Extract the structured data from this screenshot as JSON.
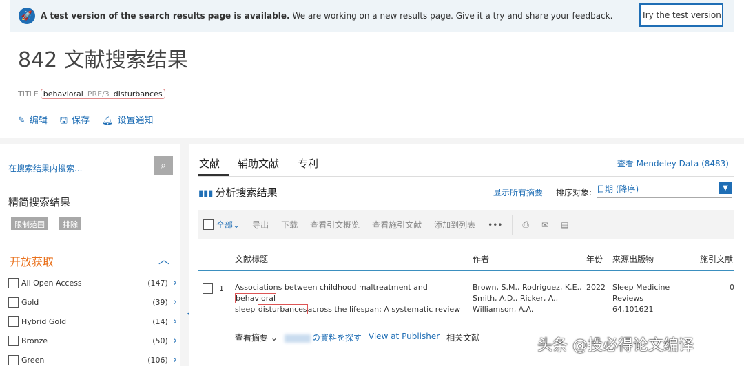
{
  "banner": {
    "bold": "A test version of the search results page is available.",
    "text": "We are working on a new results page. Give it a try and share your feedback.",
    "button": "Try the test version"
  },
  "header": {
    "title": "842 文献搜索结果",
    "field": "TITLE",
    "term1": "behavioral",
    "operator": "PRE/3",
    "term2": "disturbances",
    "actions": [
      "编辑",
      "保存",
      "设置通知"
    ]
  },
  "sidebar": {
    "search_placeholder": "在搜索结果内搜索...",
    "refine": "精简搜索结果",
    "limit": "限制范围",
    "exclude": "排除",
    "section": "开放获取",
    "filters": [
      {
        "label": "All Open Access",
        "count": "(147)"
      },
      {
        "label": "Gold",
        "count": "(39)"
      },
      {
        "label": "Hybrid Gold",
        "count": "(14)"
      },
      {
        "label": "Bronze",
        "count": "(50)"
      },
      {
        "label": "Green",
        "count": "(106)"
      }
    ]
  },
  "main": {
    "tabs": [
      "文献",
      "辅助文献",
      "专利"
    ],
    "mendeley": "查看 Mendeley Data (8483)",
    "analysis": "分析搜索结果",
    "show_all": "显示所有摘要",
    "sort_label": "排序对象:",
    "sort_value": "日期 (降序)",
    "toolbar": {
      "all": "全部",
      "items": [
        "导出",
        "下载",
        "查看引文概览",
        "查看施引文献",
        "添加到列表",
        "•••"
      ]
    },
    "columns": [
      "文献标题",
      "作者",
      "年份",
      "来源出版物",
      "施引文献"
    ],
    "rows": [
      {
        "num": "1",
        "title_a": "Associations between childhood maltreatment and",
        "hl1": "behavioral",
        "title_b": "sleep",
        "hl2": "disturbances",
        "title_c": "across the lifespan: A systematic review",
        "authors1": "Brown, S.M., Rodriguez, K.E.,",
        "authors2": "Smith, A.D., Ricker, A.,",
        "authors3": "Williamson, A.A.",
        "year": "2022",
        "source1": "Sleep Medicine",
        "source2": "Reviews",
        "source3": "64,101621",
        "cited": "0",
        "links": {
          "abstract": "查看摘要",
          "find": "の資料を探す",
          "publisher": "View at Publisher",
          "related": "相关文献"
        }
      }
    ]
  },
  "watermark": "头条 @投必得论文编译"
}
